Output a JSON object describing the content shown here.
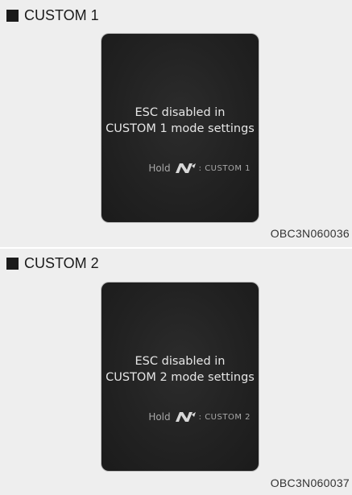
{
  "panels": [
    {
      "heading": "CUSTOM 1",
      "message_line1": "ESC disabled in",
      "message_line2": "CUSTOM 1 mode settings",
      "hold_label": "Hold",
      "hold_icon": "n-mode-icon",
      "hold_mode": ": CUSTOM 1",
      "ref_code": "OBC3N060036"
    },
    {
      "heading": "CUSTOM 2",
      "message_line1": "ESC disabled in",
      "message_line2": "CUSTOM 2 mode settings",
      "hold_label": "Hold",
      "hold_icon": "n-mode-icon",
      "hold_mode": ": CUSTOM 2",
      "ref_code": "OBC3N060037"
    }
  ]
}
